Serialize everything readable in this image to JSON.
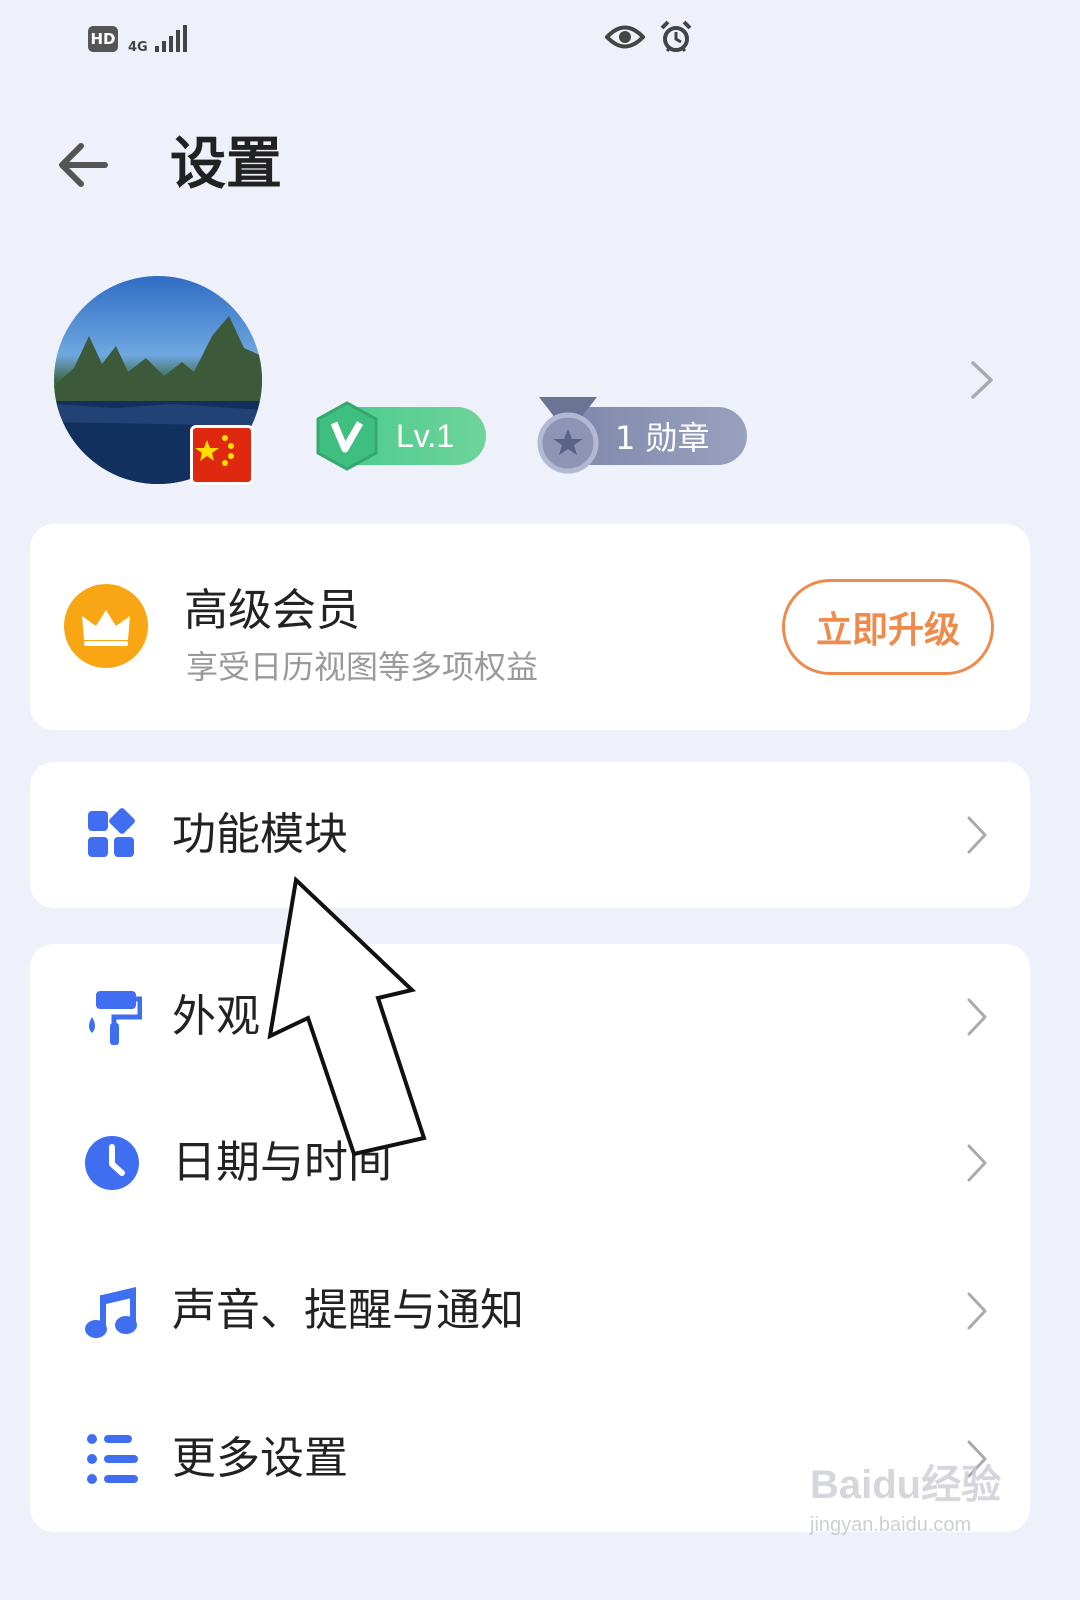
{
  "status_bar": {
    "hd": "HD",
    "network": "4G",
    "icons": [
      "hd-icon",
      "signal-icon",
      "eye-icon",
      "alarm-icon"
    ]
  },
  "header": {
    "title": "设置",
    "back_icon": "arrow-left-icon"
  },
  "profile": {
    "level": "Lv.1",
    "medals": "1 勋章"
  },
  "vip_card": {
    "title": "高级会员",
    "subtitle": "享受日历视图等多项权益",
    "button": "立即升级",
    "icon": "crown-icon"
  },
  "menu": {
    "modules": {
      "label": "功能模块",
      "icon": "grid-icon"
    },
    "items": [
      {
        "label": "外观",
        "icon": "paint-roller-icon"
      },
      {
        "label": "日期与时间",
        "icon": "clock-icon"
      },
      {
        "label": "声音、提醒与通知",
        "icon": "music-note-icon"
      },
      {
        "label": "更多设置",
        "icon": "list-settings-icon"
      }
    ]
  },
  "watermark": {
    "logo": "Baidu经验",
    "url": "jingyan.baidu.com"
  },
  "colors": {
    "background": "#eef1f9",
    "accent_blue": "#3f6ff0",
    "vip_orange": "#f9a615",
    "upgrade_orange": "#ef8a4d",
    "level_green": "#47c98c",
    "medal_gray": "#7d85a9"
  }
}
